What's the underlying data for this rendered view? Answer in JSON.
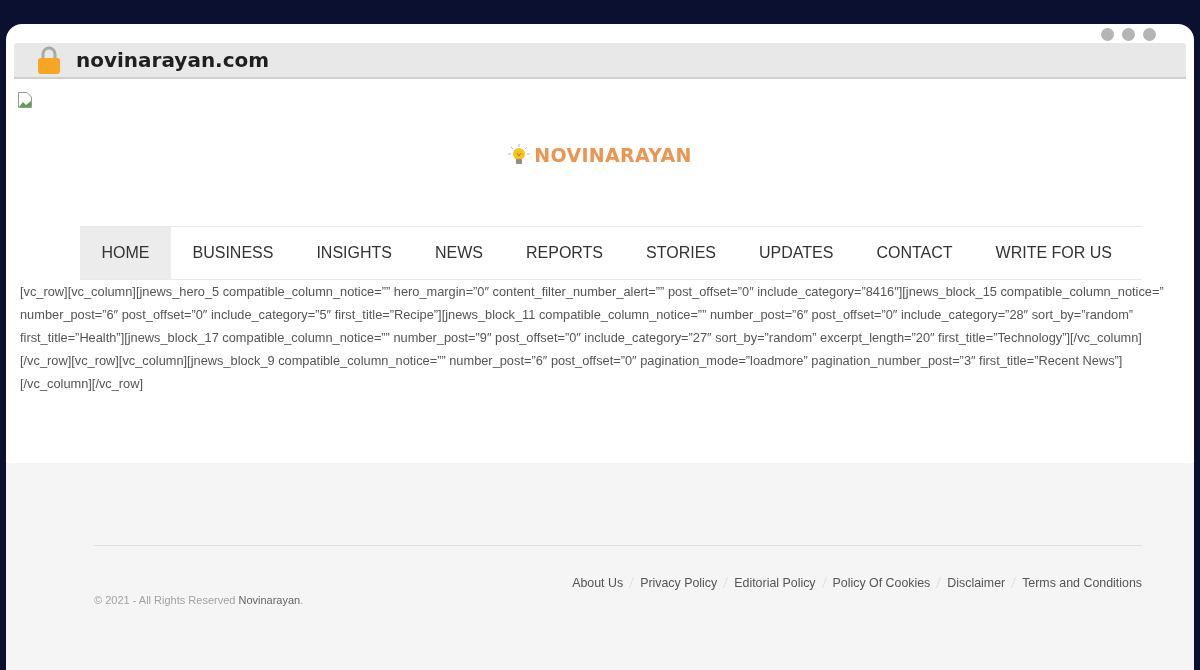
{
  "browser": {
    "url": "novinarayan.com"
  },
  "logo": {
    "text": "NOVINARAYAN"
  },
  "nav": [
    {
      "label": "HOME",
      "selected": true
    },
    {
      "label": "BUSINESS",
      "selected": false
    },
    {
      "label": "INSIGHTS",
      "selected": false
    },
    {
      "label": "NEWS",
      "selected": false
    },
    {
      "label": "REPORTS",
      "selected": false
    },
    {
      "label": "STORIES",
      "selected": false
    },
    {
      "label": "UPDATES",
      "selected": false
    },
    {
      "label": "CONTACT",
      "selected": false
    },
    {
      "label": "WRITE FOR US",
      "selected": false
    }
  ],
  "content": {
    "text": "[vc_row][vc_column][jnews_hero_5 compatible_column_notice=”” hero_margin=”0″ content_filter_number_alert=”” post_offset=”0″ include_category=”8416″][jnews_block_15 compatible_column_notice=”\nnumber_post=”6″ post_offset=”0″ include_category=”5″ first_title=”Recipe”][jnews_block_11 compatible_column_notice=”” number_post=”6″ post_offset=”0″ include_category=”28″ sort_by=”random”\nfirst_title=”Health”][jnews_block_17 compatible_column_notice=”” number_post=”9″ post_offset=”0″ include_category=”27″ sort_by=”random” excerpt_length=”20″ first_title=”Technology”][/vc_column]\n[/vc_row][vc_row][vc_column][jnews_block_9 compatible_column_notice=”” number_post=”6″ post_offset=”0″ pagination_mode=”loadmore” pagination_number_post=”3″ first_title=”Recent News”]\n[/vc_column][/vc_row]"
  },
  "footer": {
    "copyright": {
      "text": "© 2021 - All Rights Reserved",
      "link": "Novinarayan",
      "suffix": "."
    },
    "links": [
      "About Us",
      "Privacy Policy",
      "Editorial Policy",
      "Policy Of Cookies",
      "Disclaimer",
      "Terms and Conditions"
    ]
  }
}
